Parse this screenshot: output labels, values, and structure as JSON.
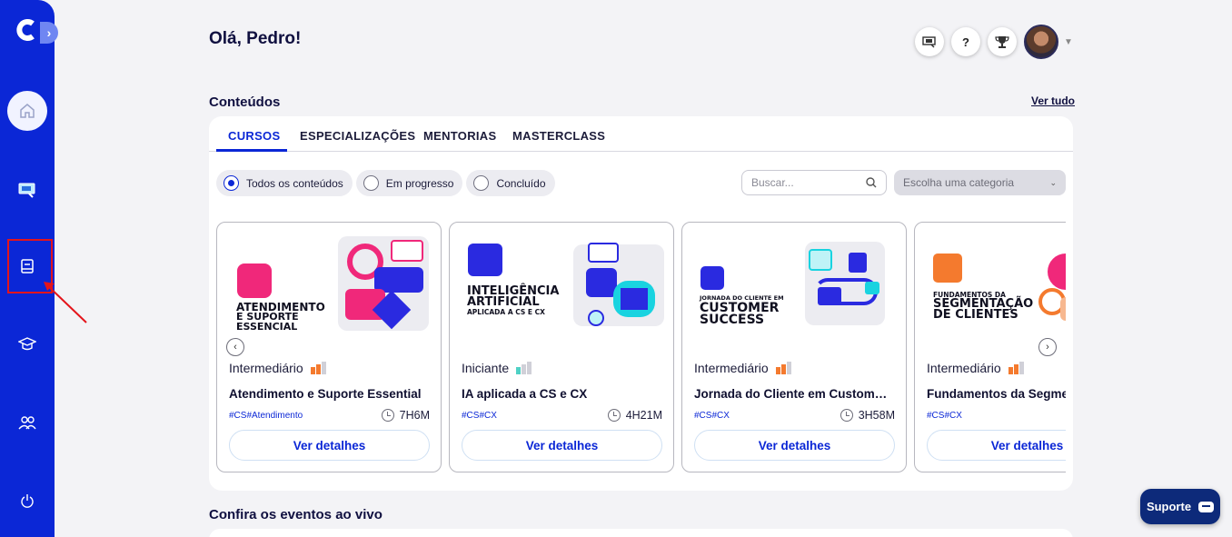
{
  "header": {
    "greeting": "Olá, Pedro!"
  },
  "contents": {
    "title": "Conteúdos",
    "see_all": "Ver tudo",
    "tabs": [
      "CURSOS",
      "ESPECIALIZAÇÕES",
      "MENTORIAS",
      "MASTERCLASS"
    ],
    "active_tab": "CURSOS",
    "filters": [
      "Todos os conteúdos",
      "Em progresso",
      "Concluído"
    ],
    "selected_filter": "Todos os conteúdos",
    "search_placeholder": "Buscar...",
    "category_placeholder": "Escolha uma categoria",
    "courses": [
      {
        "art_lines": [
          "ATENDIMENTO",
          "E SUPORTE",
          "ESSENCIAL"
        ],
        "level": "Intermediário",
        "level_bars": 2,
        "title": "Atendimento e Suporte Essential",
        "tags": "#CS#Atendimento",
        "duration": "7H6M",
        "button": "Ver detalhes",
        "accent": "#f0287a"
      },
      {
        "art_lines": [
          "INTELIGÊNCIA",
          "ARTIFICIAL",
          "APLICADA A CS E CX"
        ],
        "level": "Iniciante",
        "level_bars": 1,
        "title": "IA aplicada a CS e CX",
        "tags": "#CS#CX",
        "duration": "4H21M",
        "button": "Ver detalhes",
        "accent": "#19d3e0"
      },
      {
        "art_lines": [
          "JORNADA DO CLIENTE EM",
          "CUSTOMER",
          "SUCCESS"
        ],
        "level": "Intermediário",
        "level_bars": 2,
        "title": "Jornada do Cliente em Custom…",
        "tags": "#CS#CX",
        "duration": "3H58M",
        "button": "Ver detalhes",
        "accent": "#2a2ae0"
      },
      {
        "art_lines": [
          "FUNDAMENTOS DA",
          "SEGMENTAÇÃO",
          "DE CLIENTES"
        ],
        "level": "Intermediário",
        "level_bars": 2,
        "title": "Fundamentos da Segmentação de Clientes",
        "tags": "#CS#CX",
        "duration": "",
        "button": "Ver detalhes",
        "accent": "#f47a2e"
      }
    ]
  },
  "live_events": {
    "title": "Confira os eventos ao vivo"
  },
  "support": {
    "label": "Suporte"
  },
  "colors": {
    "brand": "#0b27d6",
    "level_active": "#f47a2e",
    "level_beginner": "#4fd1c5",
    "level_inactive": "#d0d0d8"
  }
}
